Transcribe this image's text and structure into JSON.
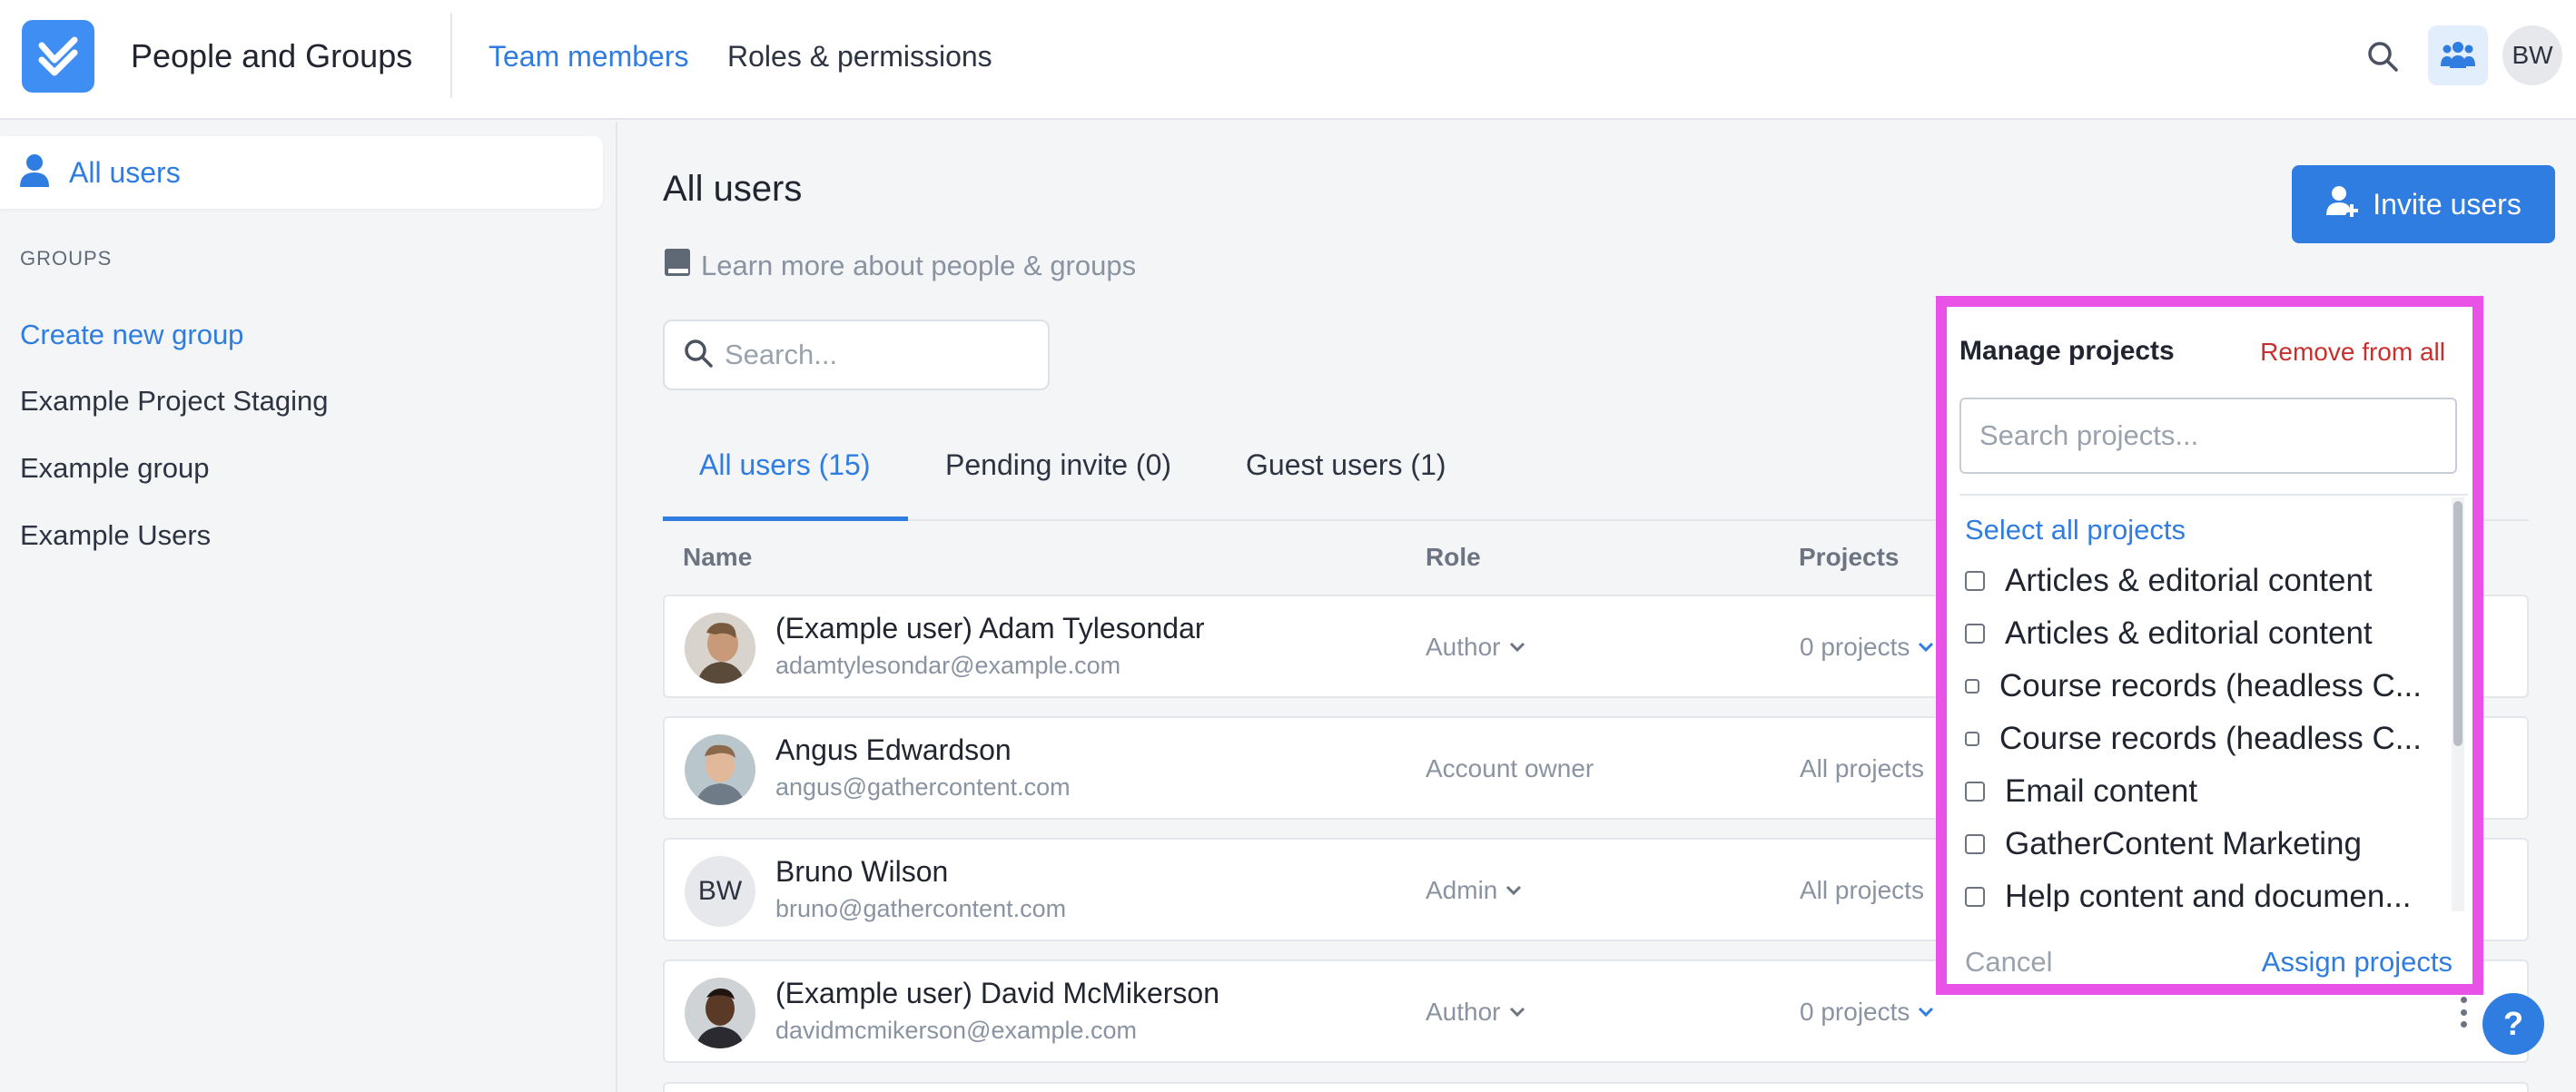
{
  "colors": {
    "accent": "#2f7de1",
    "danger": "#c9302c",
    "highlight": "#e952e6",
    "muted": "#8a93a1"
  },
  "header": {
    "app_title": "People and Groups",
    "nav": [
      {
        "label": "Team members",
        "active": true
      },
      {
        "label": "Roles & permissions",
        "active": false
      }
    ],
    "search_icon": "search-icon",
    "team_icon": "people-icon",
    "avatar_initials": "BW"
  },
  "sidebar": {
    "all_users": "All users",
    "groups_heading": "GROUPS",
    "create_group": "Create new group",
    "groups": [
      "Example Project Staging",
      "Example group",
      "Example Users"
    ]
  },
  "main": {
    "title": "All users",
    "learn_more": "Learn more about people & groups",
    "invite_button": "Invite users",
    "search_placeholder": "Search...",
    "tabs": [
      {
        "label": "All users (15)",
        "active": true
      },
      {
        "label": "Pending invite (0)",
        "active": false
      },
      {
        "label": "Guest users (1)",
        "active": false
      }
    ],
    "columns": {
      "name": "Name",
      "role": "Role",
      "projects": "Projects"
    },
    "rows": [
      {
        "name": "(Example user) Adam Tylesondar",
        "email": "adamtylesondar@example.com",
        "role": "Author",
        "role_dropdown": true,
        "projects": "0 projects",
        "projects_dropdown": true
      },
      {
        "name": "Angus Edwardson",
        "email": "angus@gathercontent.com",
        "role": "Account owner",
        "role_dropdown": false,
        "projects": "All projects",
        "projects_dropdown": false
      },
      {
        "name": "Bruno Wilson",
        "email": "bruno@gathercontent.com",
        "role": "Admin",
        "role_dropdown": true,
        "projects": "All projects",
        "projects_dropdown": false,
        "initials": "BW"
      },
      {
        "name": "(Example user) David McMikerson",
        "email": "davidmcmikerson@example.com",
        "role": "Author",
        "role_dropdown": true,
        "projects": "0 projects",
        "projects_dropdown": true
      }
    ]
  },
  "popover": {
    "title": "Manage projects",
    "remove_all": "Remove from all",
    "search_placeholder": "Search projects...",
    "select_all": "Select all projects",
    "items": [
      "Articles & editorial content",
      "Articles & editorial content",
      "Course records (headless C...",
      "Course records (headless C...",
      "Email content",
      "GatherContent Marketing",
      "Help content and documen..."
    ],
    "cancel": "Cancel",
    "assign": "Assign projects"
  },
  "help": "?"
}
